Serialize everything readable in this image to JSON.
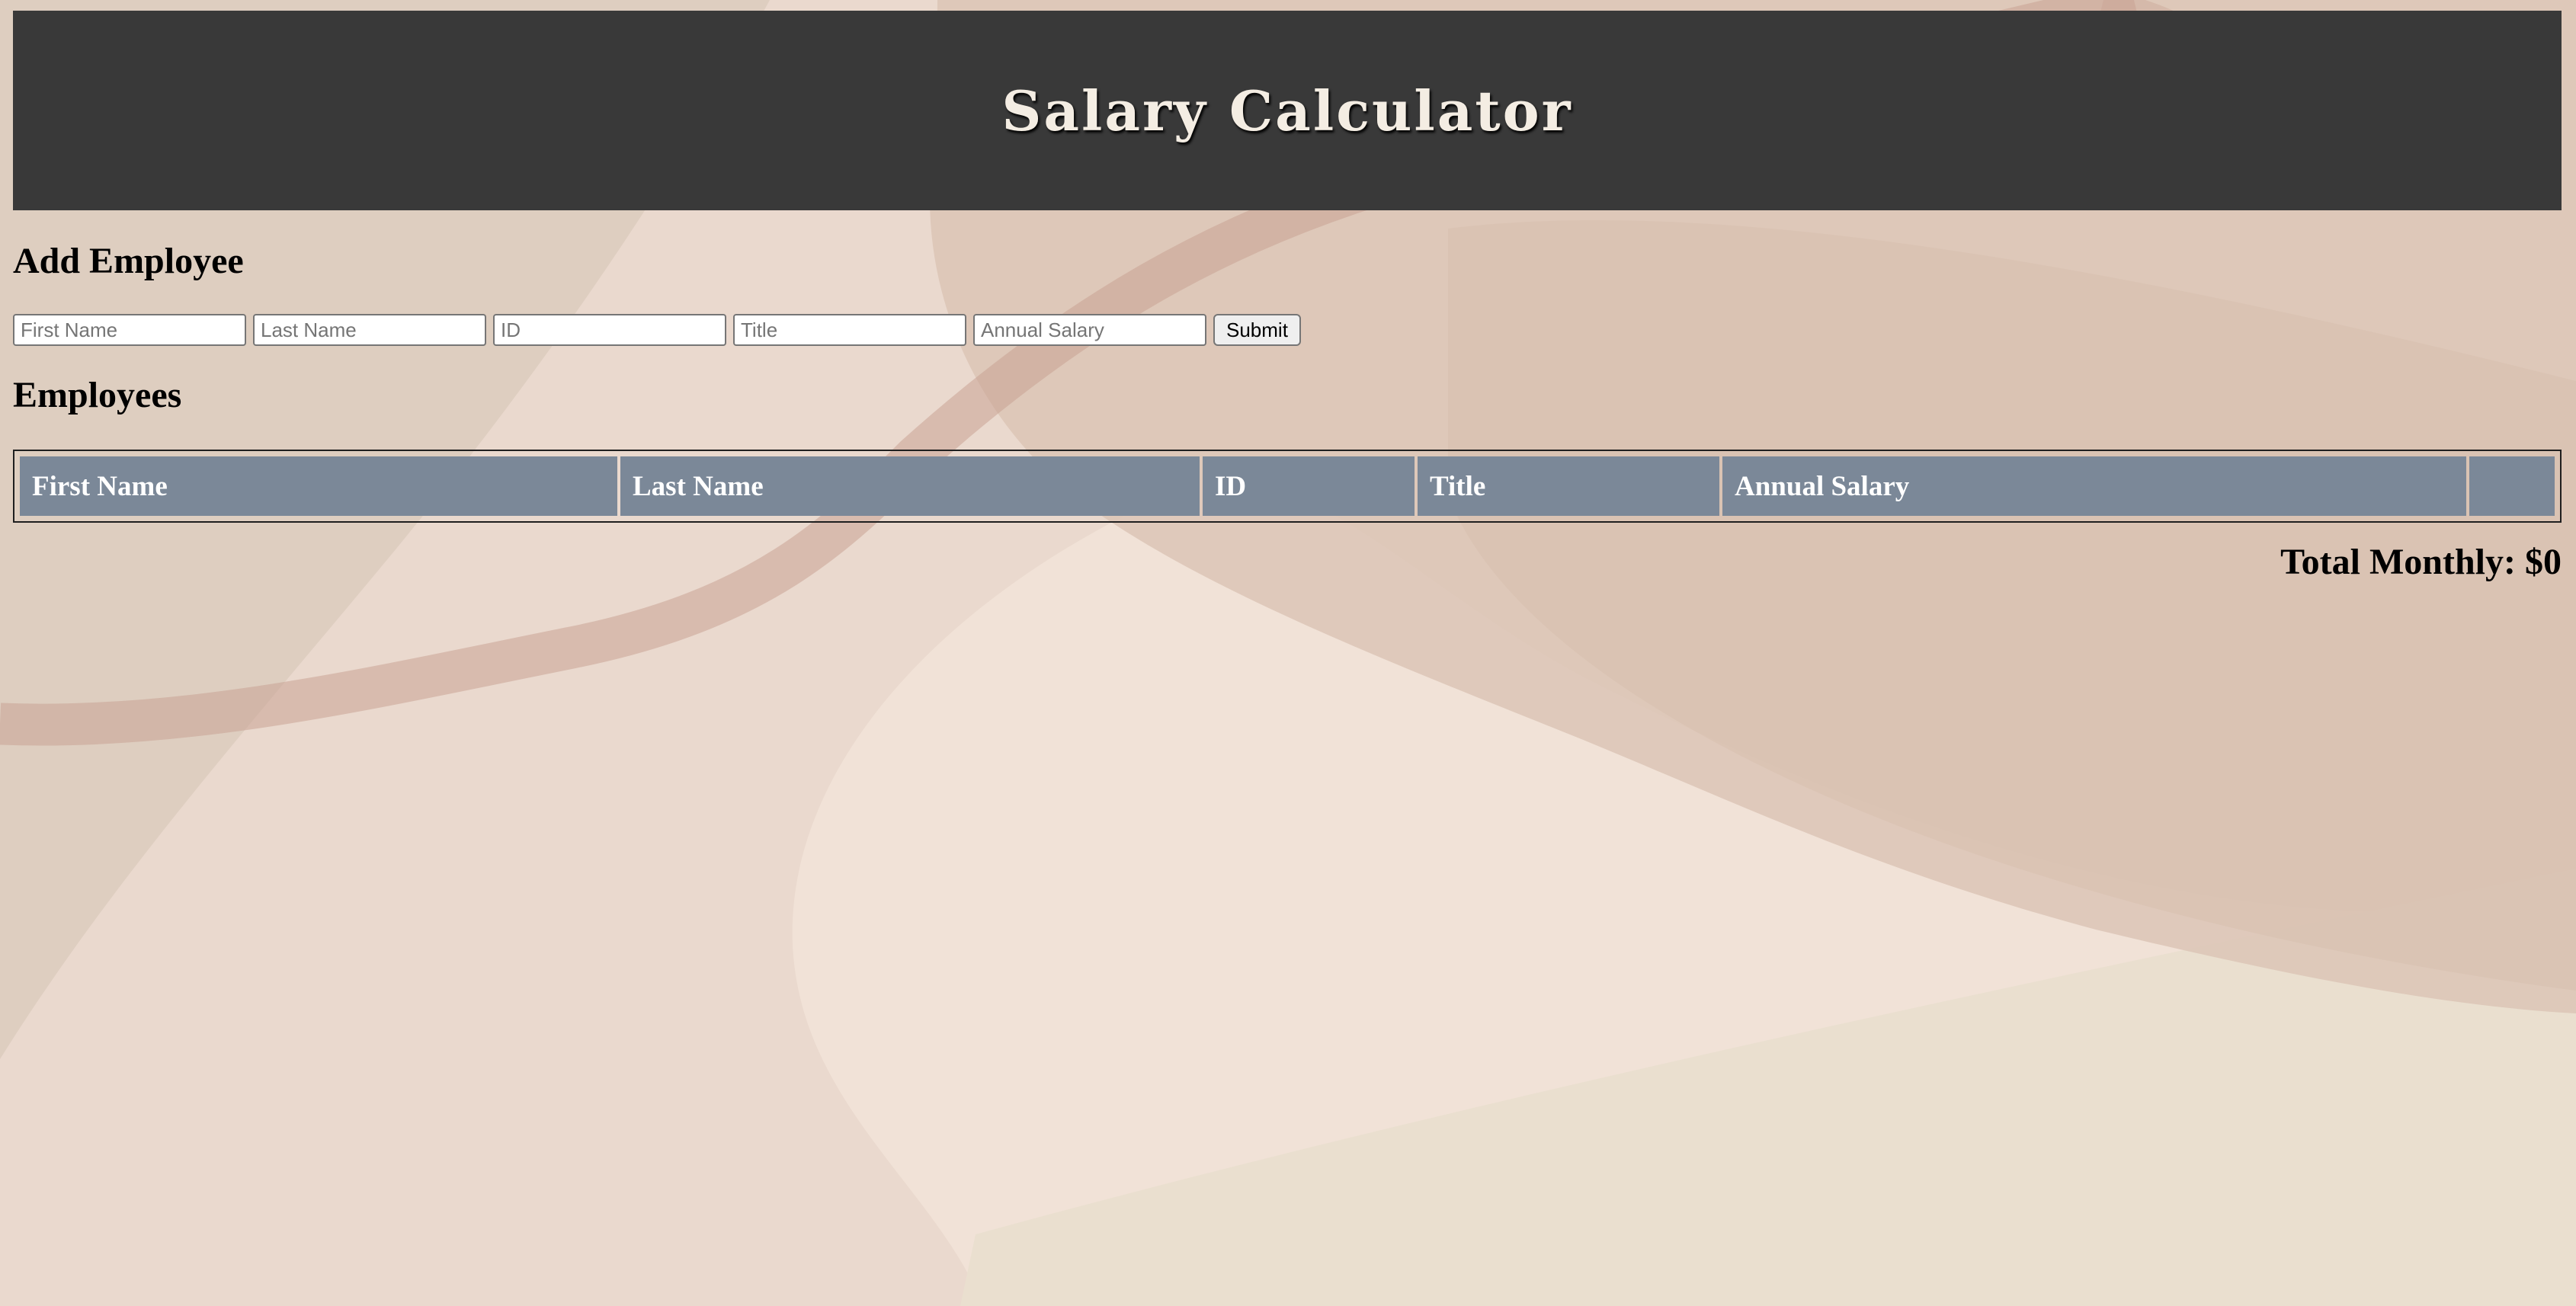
{
  "header": {
    "title": "Salary Calculator"
  },
  "add_employee": {
    "heading": "Add Employee",
    "fields": [
      {
        "name": "first-name-input",
        "placeholder": "First Name"
      },
      {
        "name": "last-name-input",
        "placeholder": "Last Name"
      },
      {
        "name": "id-input",
        "placeholder": "ID"
      },
      {
        "name": "title-input",
        "placeholder": "Title"
      },
      {
        "name": "annual-salary-input",
        "placeholder": "Annual Salary"
      }
    ],
    "submit_label": "Submit"
  },
  "employees": {
    "heading": "Employees",
    "columns": [
      "First Name",
      "Last Name",
      "ID",
      "Title",
      "Annual Salary",
      ""
    ]
  },
  "total": {
    "label": "Total Monthly: $0"
  },
  "colors": {
    "header_bg": "#393939",
    "header_text": "#f4ede3",
    "table_header_bg": "#7b8898",
    "page_bg": "#ead9ce"
  }
}
